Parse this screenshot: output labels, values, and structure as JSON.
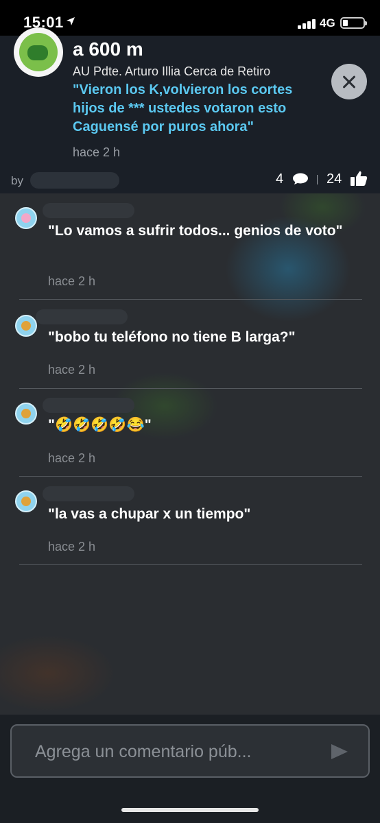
{
  "status_bar": {
    "time": "15:01",
    "network": "4G"
  },
  "alert": {
    "distance": "a 600 m",
    "street": "AU Pdte. Arturo Illia Cerca de Retiro",
    "quote": "\"Vieron los K,volvieron los cortes\nhijos de *** ustedes votaron esto\nCaguensé  por puros ahora\"",
    "time": "hace 2 h",
    "by_label": "by",
    "comment_count": "4",
    "like_count": "24"
  },
  "comments": [
    {
      "text": "\"Lo vamos a sufrir todos... genios de voto\"",
      "time": "hace 2 h",
      "avatar": "pink"
    },
    {
      "text": "\"bobo tu teléfono no tiene B larga?\"",
      "time": "hace 2 h",
      "avatar": "orange"
    },
    {
      "text": "\"🤣🤣🤣🤣😂\"",
      "time": "hace 2 h",
      "avatar": "orange"
    },
    {
      "text": "\"la vas a chupar x un tiempo\"",
      "time": "hace 2 h",
      "avatar": "orange"
    }
  ],
  "composer": {
    "placeholder": "Agrega un comentario púb..."
  },
  "colors": {
    "accent": "#5bc8f0",
    "header_bg": "#1a1f27"
  },
  "icons": [
    "location-arrow-icon",
    "signal-icon",
    "battery-icon",
    "close-icon",
    "comment-icon",
    "thumbs-up-icon",
    "send-icon"
  ]
}
